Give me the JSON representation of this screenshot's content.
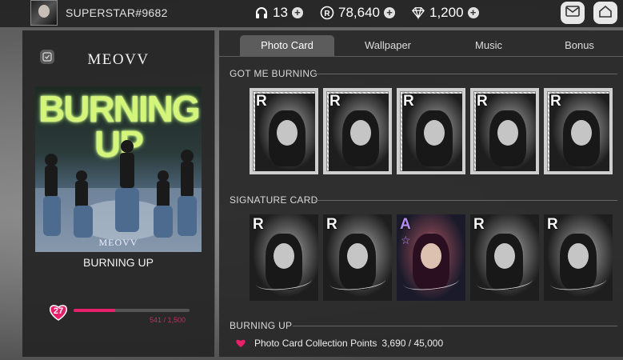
{
  "header": {
    "username": "SUPERSTAR#9682",
    "currencies": [
      {
        "name": "headphones",
        "icon": "headphones-icon",
        "value": "13"
      },
      {
        "name": "r-coin",
        "icon": "r-coin-icon",
        "value": "78,640"
      },
      {
        "name": "diamond",
        "icon": "diamond-icon",
        "value": "1,200"
      }
    ]
  },
  "album": {
    "artist": "MEOVV",
    "cover_title": "BURNING UP",
    "cover_logo": "MEOVV",
    "song_name": "BURNING UP",
    "level": "27",
    "progress_text": "541 / 1,500",
    "progress_fraction": 0.36
  },
  "tabs": [
    "Photo Card",
    "Wallpaper",
    "Music",
    "Bonus"
  ],
  "active_tab": "Photo Card",
  "sections": [
    {
      "label": "GOT ME BURNING",
      "cards": [
        "R",
        "R",
        "R",
        "R",
        "R"
      ]
    },
    {
      "label": "SIGNATURE CARD",
      "cards": [
        "R",
        "R",
        "A",
        "R",
        "R"
      ]
    },
    {
      "label": "BURNING UP"
    }
  ],
  "collection": {
    "label": "Photo Card Collection Points",
    "value": "3,690 / 45,000"
  },
  "colors": {
    "accent": "#e8206a",
    "rare_a": "#b48cf0"
  }
}
